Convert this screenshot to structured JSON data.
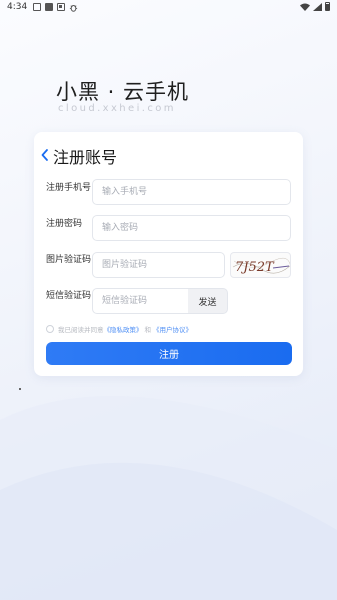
{
  "status_bar": {
    "time": "4:34",
    "icons": [
      "image-icon",
      "square-icon",
      "camera-icon",
      "bug-icon",
      "wifi-icon",
      "signal-icon",
      "battery-icon"
    ]
  },
  "brand": {
    "title": "小黑 · 云手机",
    "subtitle": "cloud.xxhei.com"
  },
  "form": {
    "title": "注册账号",
    "phone": {
      "label": "注册手机号",
      "placeholder": "输入手机号",
      "value": ""
    },
    "password": {
      "label": "注册密码",
      "placeholder": "输入密码",
      "value": ""
    },
    "captcha": {
      "label": "图片验证码",
      "placeholder": "图片验证码",
      "value": "",
      "image_text": "7J52T"
    },
    "sms": {
      "label": "短信验证码",
      "placeholder": "短信验证码",
      "value": "",
      "send_label": "发送"
    },
    "agreement": {
      "prefix": "我已阅读并同意",
      "privacy": "《隐私政策》",
      "and": "和",
      "user": "《用户协议》",
      "checked": false
    },
    "submit_label": "注册"
  },
  "colors": {
    "primary": "#1a6cf0",
    "link": "#4d8ef5",
    "placeholder": "#a8acb5"
  }
}
